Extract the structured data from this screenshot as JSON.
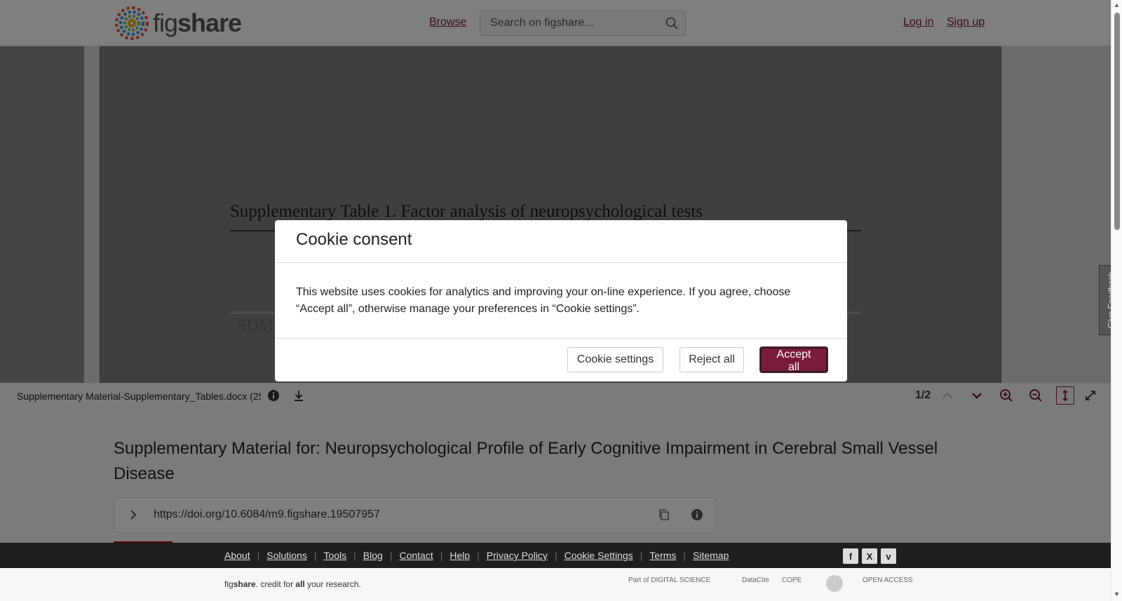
{
  "header": {
    "logo_text_light": "fig",
    "logo_text_bold": "share",
    "browse_label": "Browse",
    "search_placeholder": "Search on figshare...",
    "login_label": "Log in",
    "signup_label": "Sign up"
  },
  "viewer": {
    "doc_title": "Supplementary Table 1. Factor analysis of neuropsychological tests",
    "doc_fragment": "SDM",
    "file_name": "Supplementary Material-Supplementary_Tables.docx (25",
    "page_indicator": "1/2"
  },
  "article": {
    "title": "Supplementary Material for: Neuropsychological Profile of Early Cognitive Impairment in Cerebral Small Vessel Disease",
    "doi": "https://doi.org/10.6084/m9.figshare.19507957"
  },
  "cookie_modal": {
    "title": "Cookie consent",
    "body": "This website uses cookies for analytics and improving your on-line experience. If you agree, choose “Accept all”, otherwise manage your preferences in “Cookie settings”.",
    "settings_label": "Cookie settings",
    "reject_label": "Reject all",
    "accept_label": "Accept all"
  },
  "feedback_label": "Give Feedback",
  "footer": {
    "links": [
      "About",
      "Solutions",
      "Tools",
      "Blog",
      "Contact",
      "Help",
      "Privacy Policy",
      "Cookie Settings",
      "Terms",
      "Sitemap"
    ],
    "social": [
      "f",
      "X",
      "v"
    ],
    "tagline_fig": "fig",
    "tagline_share": "share",
    "tagline_mid": ". credit for ",
    "tagline_all": "all",
    "tagline_end": " your research.",
    "partners": [
      "Part of DIGITAL SCIENCE",
      "DataCite",
      "COPE",
      "",
      "OPEN ACCESS"
    ]
  },
  "colors": {
    "brand": "#7a1a3c",
    "footer_bg": "#1f1f1f"
  }
}
